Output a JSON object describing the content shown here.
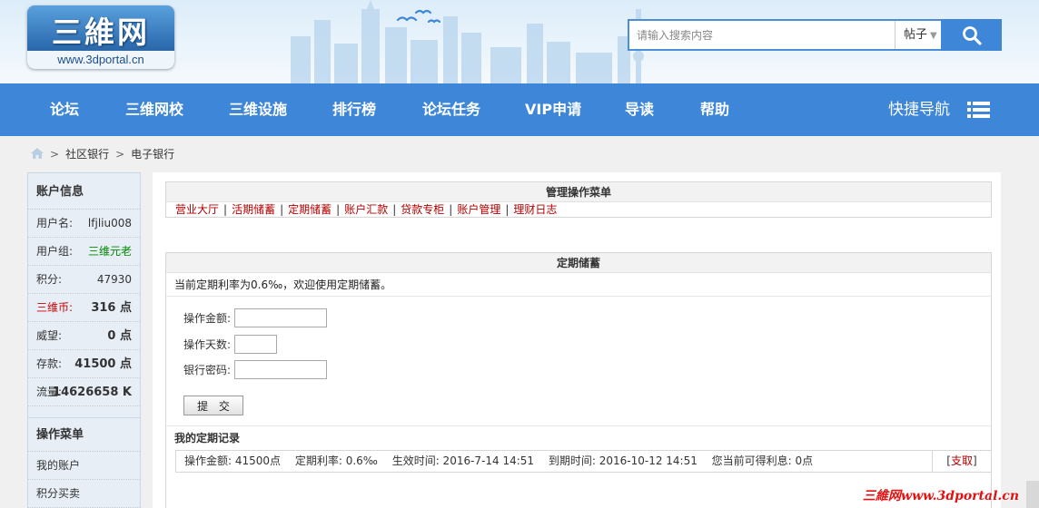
{
  "header": {
    "logo_text": "三維网",
    "logo_url": "www.3dportal.cn",
    "search": {
      "placeholder": "请输入搜索内容",
      "type_selected": "帖子"
    }
  },
  "nav": {
    "items": [
      "论坛",
      "三维网校",
      "三维设施",
      "排行榜",
      "论坛任务",
      "VIP申请",
      "导读",
      "帮助"
    ],
    "quick_nav": "快捷导航"
  },
  "breadcrumb": {
    "items": [
      "社区银行",
      "电子银行"
    ],
    "separator": ">"
  },
  "sidebar": {
    "account_title": "账户信息",
    "stats": [
      {
        "label": "用户名:",
        "value": "lfjliu008"
      },
      {
        "label": "用户组:",
        "value": "三维元老"
      },
      {
        "label": "积分:",
        "value": "47930"
      },
      {
        "label": "三维币:",
        "value": "316 点"
      },
      {
        "label": "威望:",
        "value": "0 点"
      },
      {
        "label": "存款:",
        "value": "41500 点"
      },
      {
        "label": "流量:",
        "value": "14626658 K"
      }
    ],
    "menu_title": "操作菜单",
    "menu_items": [
      "我的账户",
      "积分买卖"
    ]
  },
  "main": {
    "mgmt_title": "管理操作菜单",
    "mgmt_menu": [
      "营业大厅",
      "活期储蓄",
      "定期储蓄",
      "账户汇款",
      "贷款专柜",
      "账户管理",
      "理财日志"
    ],
    "fixed": {
      "title": "定期储蓄",
      "rate_text": "当前定期利率为0.6‰，欢迎使用定期储蓄。",
      "labels": {
        "amount": "操作金额:",
        "days": "操作天数:",
        "password": "银行密码:"
      },
      "values": {
        "amount": "",
        "days": "",
        "password": ""
      },
      "submit": "提 交",
      "records_title": "我的定期记录"
    },
    "record": {
      "text": "操作金额: 41500点　 定期利率: 0.6‰　 生效时间: 2016-7-14 14:51　 到期时间: 2016-10-12 14:51　 您当前可得利息: 0点",
      "action_open": "[",
      "action_label": "支取",
      "action_close": "]"
    }
  },
  "watermark": "三維网www.3dportal.cn",
  "colors": {
    "nav_bg": "#3d86d8",
    "link_red": "#b30000",
    "sidebar_bg": "#e7eef6",
    "group_green": "#008800"
  }
}
